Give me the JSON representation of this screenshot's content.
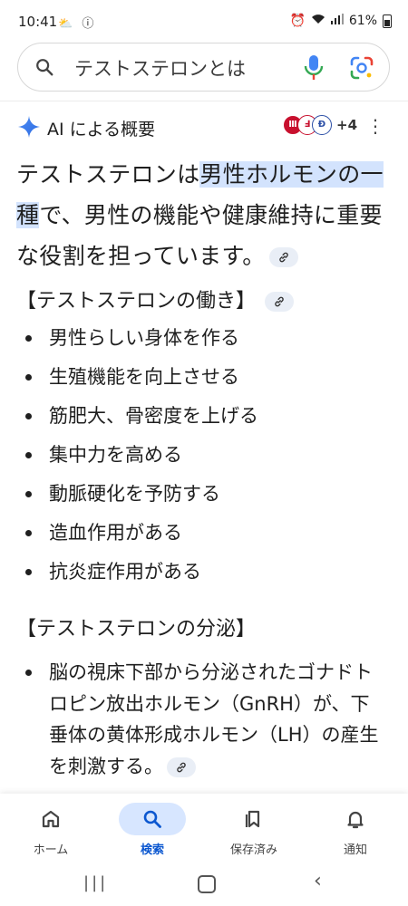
{
  "status_bar": {
    "time": "10:41",
    "battery": "61%"
  },
  "search": {
    "query": "テストステロンとは"
  },
  "ai_overview": {
    "title": "AI による概要",
    "source_more": "+4",
    "summary_part1": "テストステロンは",
    "summary_highlight": "男性ホルモンの一種",
    "summary_part2": "で、男性の機能や健康維持に重要な役割を担っています。"
  },
  "section_function": {
    "heading": "【テストステロンの働き】",
    "items": [
      "男性らしい身体を作る",
      "生殖機能を向上させる",
      "筋肥大、骨密度を上げる",
      "集中力を高める",
      "動脈硬化を予防する",
      "造血作用がある",
      "抗炎症作用がある"
    ]
  },
  "section_secretion": {
    "heading": "【テストステロンの分泌】",
    "paragraph": "脳の視床下部から分泌されたゴナドトロピン放出ホルモン（GnRH）が、下垂体の黄体形成ホルモン（LH）の産生を刺激する。"
  },
  "bottom_nav": {
    "home": "ホーム",
    "search": "検索",
    "saved": "保存済み",
    "notifications": "通知"
  },
  "colors": {
    "accent": "#0b57d0",
    "highlight": "#d3e3fd",
    "active_pill": "#d7e6ff"
  }
}
